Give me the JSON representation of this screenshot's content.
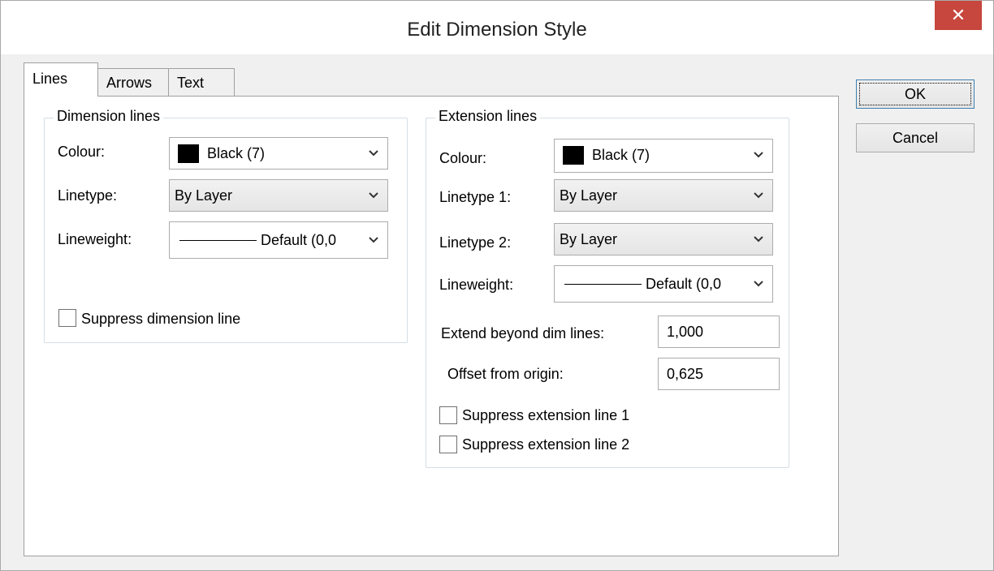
{
  "window": {
    "title": "Edit Dimension Style",
    "close_symbol": "✕"
  },
  "tabs": [
    {
      "label": "Lines",
      "active": true
    },
    {
      "label": "Arrows",
      "active": false
    },
    {
      "label": "Text",
      "active": false
    }
  ],
  "dimension_lines": {
    "title": "Dimension lines",
    "colour_label": "Colour:",
    "colour_value": "Black (7)",
    "colour_swatch": "#000000",
    "linetype_label": "Linetype:",
    "linetype_value": "By Layer",
    "lineweight_label": "Lineweight:",
    "lineweight_value": "Default (0,0",
    "suppress_label": "Suppress dimension line",
    "suppress_checked": false
  },
  "extension_lines": {
    "title": "Extension lines",
    "colour_label": "Colour:",
    "colour_value": "Black (7)",
    "colour_swatch": "#000000",
    "linetype1_label": "Linetype 1:",
    "linetype1_value": "By Layer",
    "linetype2_label": "Linetype 2:",
    "linetype2_value": "By Layer",
    "lineweight_label": "Lineweight:",
    "lineweight_value": "Default (0,0",
    "extend_label": "Extend beyond dim lines:",
    "extend_value": "1,000",
    "offset_label": "Offset from origin:",
    "offset_value": "0,625",
    "suppress1_label": "Suppress extension line 1",
    "suppress1_checked": false,
    "suppress2_label": "Suppress extension line 2",
    "suppress2_checked": false
  },
  "buttons": {
    "ok_label": "OK",
    "cancel_label": "Cancel"
  },
  "colors": {
    "close_button": "#c7463d",
    "default_button_border": "#3c7fb1"
  }
}
